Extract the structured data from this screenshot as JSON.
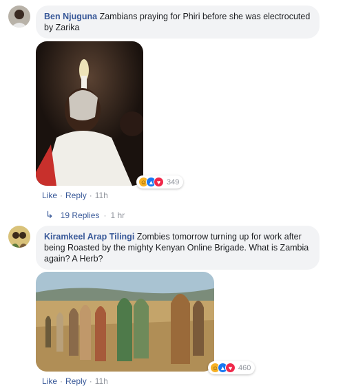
{
  "comments": [
    {
      "author": "Ben Njuguna",
      "text": "Zambians praying for Phiri before she was electrocuted by Zarika",
      "reaction_icons": [
        "haha-icon",
        "like-icon",
        "love-icon"
      ],
      "reaction_count": "349",
      "like_label": "Like",
      "reply_label": "Reply",
      "time": "11h",
      "replies_label": "19 Replies",
      "replies_time": "1 hr"
    },
    {
      "author": "Kiramkeel Arap Tilingi",
      "text": "Zombies tomorrow turning up for work after being Roasted by the mighty Kenyan Online Brigade. What is Zambia again? A Herb?",
      "reaction_icons": [
        "haha-icon",
        "like-icon",
        "love-icon"
      ],
      "reaction_count": "460",
      "like_label": "Like",
      "reply_label": "Reply",
      "time": "11h"
    }
  ],
  "colors": {
    "link": "#385898",
    "meta": "#90949c",
    "bubble": "#f2f3f5"
  }
}
